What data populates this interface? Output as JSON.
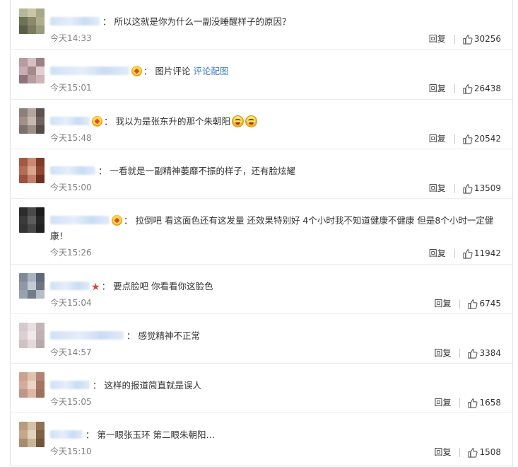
{
  "colors": {
    "link": "#3a7bd5",
    "time": "#808080",
    "text": "#333333",
    "divider": "#ececec"
  },
  "reply_label": "回复",
  "comments": [
    {
      "nick_width": 70,
      "prefix": "",
      "badge": false,
      "star": false,
      "text": "所以这就是你为什么一副没睡醒样子的原因？",
      "link": "",
      "emojis": 0,
      "time": "今天14:33",
      "likes": "30256",
      "avatar": [
        "#b5b79a",
        "#c9c6a6",
        "#a8a886",
        "#6f7355",
        "#8c8a6a",
        "#b0ae90",
        "#5a5e48",
        "#7c7a5f",
        "#9a9a7e"
      ]
    },
    {
      "nick_width": 112,
      "prefix": "",
      "badge": true,
      "star": false,
      "text": "图片评论",
      "link": "评论配图",
      "emojis": 0,
      "time": "今天15:01",
      "likes": "26438",
      "avatar": [
        "#b89a9f",
        "#d5bfc3",
        "#9d7f86",
        "#c8aeb2",
        "#a48a8f",
        "#e0cfd2",
        "#8e747a",
        "#b79ca1",
        "#cdb4b8"
      ]
    },
    {
      "nick_width": 56,
      "prefix": "",
      "badge": true,
      "star": false,
      "text": "我以为是张东升的那个朱朝阳",
      "link": "",
      "emojis": 2,
      "time": "今天15:48",
      "likes": "20542",
      "avatar": [
        "#8d7f7b",
        "#b3a6a0",
        "#5e514e",
        "#a18f88",
        "#c6b8b1",
        "#6f625e",
        "#7e706b",
        "#9c8e88",
        "#574b47"
      ]
    },
    {
      "nick_width": 64,
      "prefix": "",
      "badge": false,
      "star": false,
      "text": "一看就是一副精神萎靡不振的样子，还有脸炫耀",
      "link": "",
      "emojis": 0,
      "time": "今天15:00",
      "likes": "13509",
      "avatar": [
        "#a35a45",
        "#c98a70",
        "#7e3b2a",
        "#b56d55",
        "#d8a68c",
        "#8c4631",
        "#9b533f",
        "#c2806a",
        "#6e3022"
      ]
    },
    {
      "nick_width": 84,
      "prefix": "",
      "badge": true,
      "star": false,
      "text": "拉倒吧 看这面色还有这发量 还效果特别好 4个小时我不知道健康不健康 但是8个小时一定健康！",
      "link": "",
      "emojis": 0,
      "time": "今天15:26",
      "likes": "11942",
      "wrap": true,
      "avatar": [
        "#2c2c2c",
        "#4a4a4a",
        "#1c1c1c",
        "#3a3a3a",
        "#5c5c5c",
        "#262626",
        "#343434",
        "#484848",
        "#202020"
      ]
    },
    {
      "nick_width": 56,
      "prefix": "",
      "badge": false,
      "star": true,
      "text": "要点脸吧 你看看你这脸色",
      "link": "",
      "emojis": 0,
      "time": "今天15:04",
      "likes": "6745",
      "avatar": [
        "#7f8a9a",
        "#a9b3c0",
        "#5d6878",
        "#8e98a6",
        "#c2cad4",
        "#6b7584",
        "#98a2ae",
        "#717c8b",
        "#b4bdc8"
      ]
    },
    {
      "nick_width": 104,
      "prefix": "",
      "badge": false,
      "star": false,
      "text": "感觉精神不正常",
      "link": "",
      "emojis": 0,
      "time": "今天14:57",
      "likes": "3384",
      "avatar": [
        "#d4c9cc",
        "#e8dfe1",
        "#c3b4b8",
        "#dccfd2",
        "#f0e8ea",
        "#bfb0b4",
        "#cfc2c5",
        "#e3d8da",
        "#b8a9ad"
      ]
    },
    {
      "nick_width": 56,
      "prefix": "",
      "badge": false,
      "star": false,
      "text": "这样的报道简直就是误人",
      "link": "",
      "emojis": 0,
      "time": "今天15:05",
      "likes": "1658",
      "avatar": [
        "#caa28f",
        "#e0c1b0",
        "#b08471",
        "#d3ad9a",
        "#ecd3c4",
        "#a47562",
        "#c1968a",
        "#dbb7a4",
        "#9c6e5c"
      ]
    },
    {
      "nick_width": 46,
      "prefix": "",
      "badge": false,
      "star": false,
      "text": "第一眼张玉环 第二眼朱朝阳…",
      "link": "",
      "emojis": 0,
      "time": "今天15:10",
      "likes": "1508",
      "avatar": [
        "#b89c7e",
        "#d6c0a6",
        "#8e7256",
        "#c3a889",
        "#e3d2bc",
        "#7c6146",
        "#a88c6e",
        "#cdb497",
        "#6f563c"
      ]
    }
  ]
}
